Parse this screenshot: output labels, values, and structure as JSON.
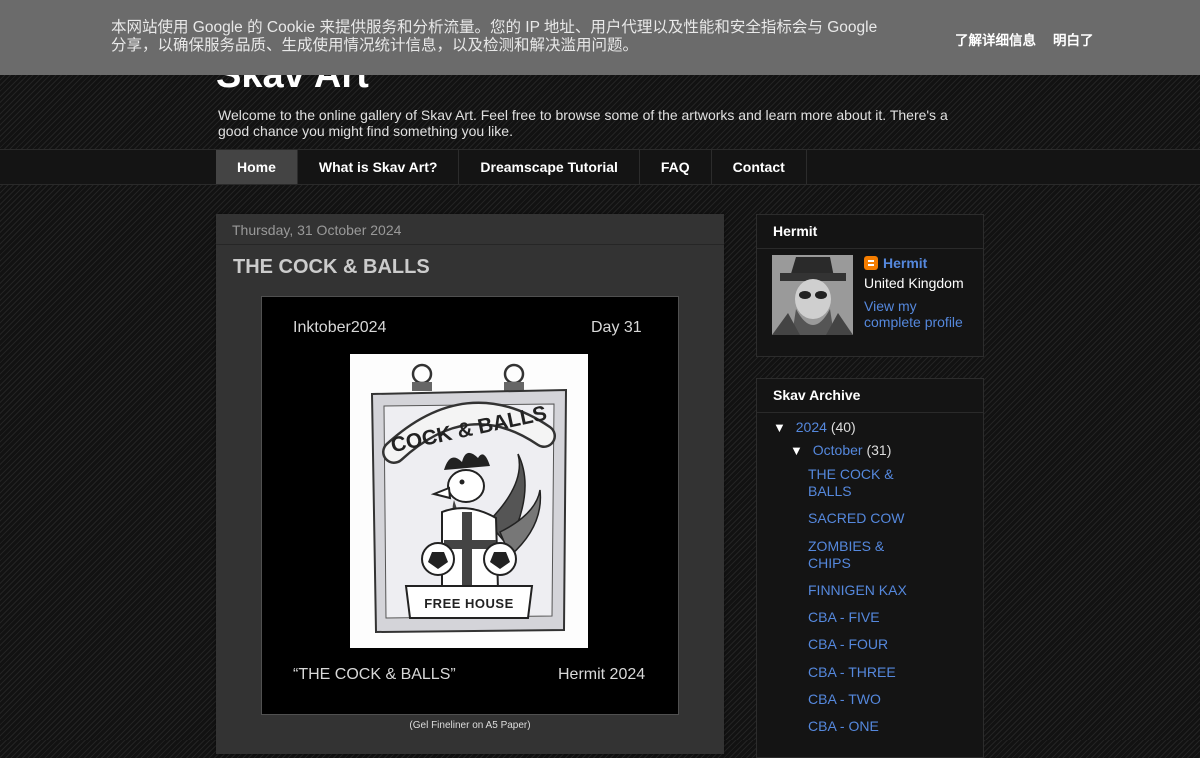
{
  "cookie": {
    "text_line1": "本网站使用 Google 的 Cookie 来提供服务和分析流量。您的 IP 地址、用户代理以及性能和安全指标会与 Google",
    "text_line2": "分享，以确保服务品质、生成使用情况统计信息，以及检测和解决滥用问题。",
    "learn_more": "了解详细信息",
    "ok": "明白了"
  },
  "header": {
    "title": "Skav Art",
    "description": "Welcome to the online gallery of Skav Art. Feel free to browse some of the artworks and learn more about it. There's a good chance you might find something you like."
  },
  "nav": {
    "tabs": [
      {
        "label": "Home",
        "active": true
      },
      {
        "label": "What is Skav Art?"
      },
      {
        "label": "Dreamscape Tutorial"
      },
      {
        "label": "FAQ"
      },
      {
        "label": "Contact"
      }
    ]
  },
  "post": {
    "date": "Thursday, 31 October 2024",
    "title": "THE COCK & BALLS",
    "image": {
      "top_left": "Inktober2024",
      "top_right": "Day 31",
      "bottom_left": "“THE COCK & BALLS”",
      "bottom_right": "Hermit 2024",
      "sign_title": "COCK & BALLS",
      "sign_footer": "FREE HOUSE"
    },
    "caption": "(Gel Fineliner on A5 Paper)"
  },
  "profile": {
    "widget_title": "Hermit",
    "name": "Hermit",
    "location": "United Kingdom",
    "link": "View my complete profile"
  },
  "archive": {
    "widget_title": "Skav Archive",
    "year": {
      "label": "2024",
      "count": "(40)",
      "toggle": "▼"
    },
    "month": {
      "label": "October",
      "count": "(31)",
      "toggle": "▼"
    },
    "posts": [
      "THE COCK & BALLS",
      "SACRED COW",
      "ZOMBIES & CHIPS",
      "FINNIGEN KAX",
      "CBA - FIVE",
      "CBA - FOUR",
      "CBA - THREE",
      "CBA - TWO",
      "CBA - ONE"
    ]
  },
  "colors": {
    "link": "#5588dd",
    "cookie_bar": "#6b6b6b",
    "active_tab": "#444444",
    "blogger_orange": "#f57d00"
  }
}
